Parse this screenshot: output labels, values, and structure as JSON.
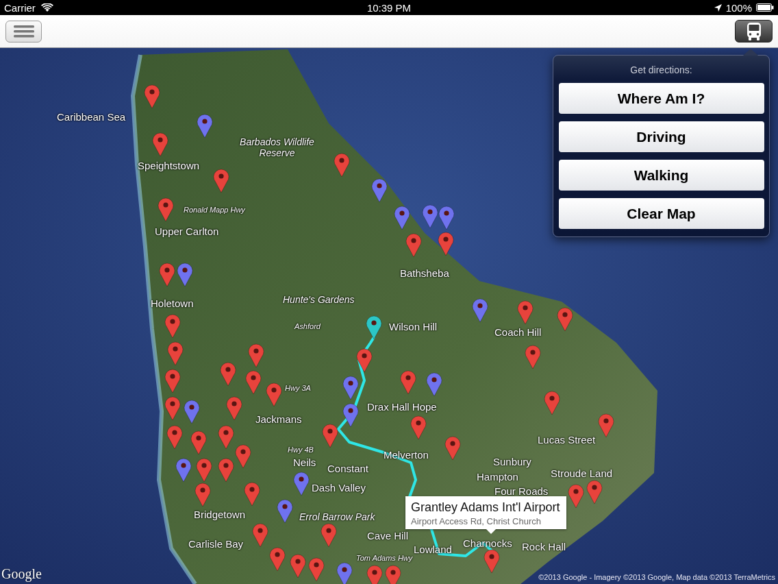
{
  "status_bar": {
    "carrier": "Carrier",
    "time": "10:39 PM",
    "battery": "100%"
  },
  "map": {
    "labels": [
      {
        "text": "Caribbean Sea",
        "kind": "place"
      },
      {
        "text": "Speightstown",
        "kind": "place"
      },
      {
        "text": "Barbados Wildlife Reserve",
        "kind": "poi"
      },
      {
        "text": "Ronald Mapp Hwy",
        "kind": "road"
      },
      {
        "text": "Upper Carlton",
        "kind": "place"
      },
      {
        "text": "Bathsheba",
        "kind": "place"
      },
      {
        "text": "Holetown",
        "kind": "place"
      },
      {
        "text": "Hunte's Gardens",
        "kind": "poi"
      },
      {
        "text": "Wilson Hill",
        "kind": "place"
      },
      {
        "text": "Ashford",
        "kind": "road"
      },
      {
        "text": "Coach Hill",
        "kind": "place"
      },
      {
        "text": "Hwy 3A",
        "kind": "road"
      },
      {
        "text": "Drax Hall Hope",
        "kind": "place"
      },
      {
        "text": "Jackmans",
        "kind": "place"
      },
      {
        "text": "Hwy 4B",
        "kind": "road"
      },
      {
        "text": "Melverton",
        "kind": "place"
      },
      {
        "text": "Lucas Street",
        "kind": "place"
      },
      {
        "text": "Neils",
        "kind": "place"
      },
      {
        "text": "Constant",
        "kind": "place"
      },
      {
        "text": "Sunbury",
        "kind": "place"
      },
      {
        "text": "Hampton",
        "kind": "place"
      },
      {
        "text": "Stroude Land",
        "kind": "place"
      },
      {
        "text": "Dash Valley",
        "kind": "place"
      },
      {
        "text": "Four Roads",
        "kind": "place"
      },
      {
        "text": "Bridgetown",
        "kind": "place"
      },
      {
        "text": "Errol Barrow Park",
        "kind": "poi"
      },
      {
        "text": "Cave Hill",
        "kind": "place"
      },
      {
        "text": "Carlisle Bay",
        "kind": "place"
      },
      {
        "text": "Tom Adams Hwy",
        "kind": "road"
      },
      {
        "text": "Lowland",
        "kind": "place"
      },
      {
        "text": "Charnocks",
        "kind": "place"
      },
      {
        "text": "Rock Hall",
        "kind": "place"
      }
    ],
    "pins": [
      {
        "color": "#e8433c"
      },
      {
        "color": "#e8433c"
      },
      {
        "color": "#e8433c"
      },
      {
        "color": "#e8433c"
      },
      {
        "color": "#e8433c"
      },
      {
        "color": "#e8433c"
      },
      {
        "color": "#e8433c"
      },
      {
        "color": "#e8433c"
      },
      {
        "color": "#e8433c"
      },
      {
        "color": "#e8433c"
      },
      {
        "color": "#e8433c"
      },
      {
        "color": "#e8433c"
      },
      {
        "color": "#e8433c"
      },
      {
        "color": "#e8433c"
      },
      {
        "color": "#e8433c"
      },
      {
        "color": "#e8433c"
      },
      {
        "color": "#e8433c"
      },
      {
        "color": "#e8433c"
      },
      {
        "color": "#e8433c"
      },
      {
        "color": "#e8433c"
      },
      {
        "color": "#e8433c"
      },
      {
        "color": "#e8433c"
      },
      {
        "color": "#e8433c"
      },
      {
        "color": "#e8433c"
      },
      {
        "color": "#e8433c"
      },
      {
        "color": "#e8433c"
      },
      {
        "color": "#e8433c"
      },
      {
        "color": "#e8433c"
      },
      {
        "color": "#e8433c"
      },
      {
        "color": "#e8433c"
      },
      {
        "color": "#e8433c"
      },
      {
        "color": "#e8433c"
      },
      {
        "color": "#e8433c"
      },
      {
        "color": "#e8433c"
      },
      {
        "color": "#e8433c"
      },
      {
        "color": "#e8433c"
      },
      {
        "color": "#e8433c"
      },
      {
        "color": "#e8433c"
      },
      {
        "color": "#e8433c"
      },
      {
        "color": "#e8433c"
      },
      {
        "color": "#e8433c"
      },
      {
        "color": "#e8433c"
      },
      {
        "color": "#e8433c"
      },
      {
        "color": "#e8433c"
      },
      {
        "color": "#6f72ee"
      },
      {
        "color": "#6f72ee"
      },
      {
        "color": "#6f72ee"
      },
      {
        "color": "#6f72ee"
      },
      {
        "color": "#6f72ee"
      },
      {
        "color": "#6f72ee"
      },
      {
        "color": "#6f72ee"
      },
      {
        "color": "#6f72ee"
      },
      {
        "color": "#6f72ee"
      },
      {
        "color": "#6f72ee"
      },
      {
        "color": "#6f72ee"
      },
      {
        "color": "#6f72ee"
      },
      {
        "color": "#6f72ee"
      },
      {
        "color": "#6f72ee"
      },
      {
        "color": "#6f72ee"
      },
      {
        "color": "#2cc6c6"
      },
      {
        "color": "#e8433c"
      }
    ],
    "callout": {
      "title": "Grantley Adams Int'l Airport",
      "subtitle": "Airport Access Rd, Christ Church"
    },
    "logo": "Google",
    "attribution": "©2013 Google - Imagery ©2013 Google, Map data ©2013 TerraMetrics"
  },
  "popover": {
    "title": "Get directions:",
    "buttons": [
      "Where Am I?",
      "Driving",
      "Walking",
      "Clear Map"
    ]
  }
}
